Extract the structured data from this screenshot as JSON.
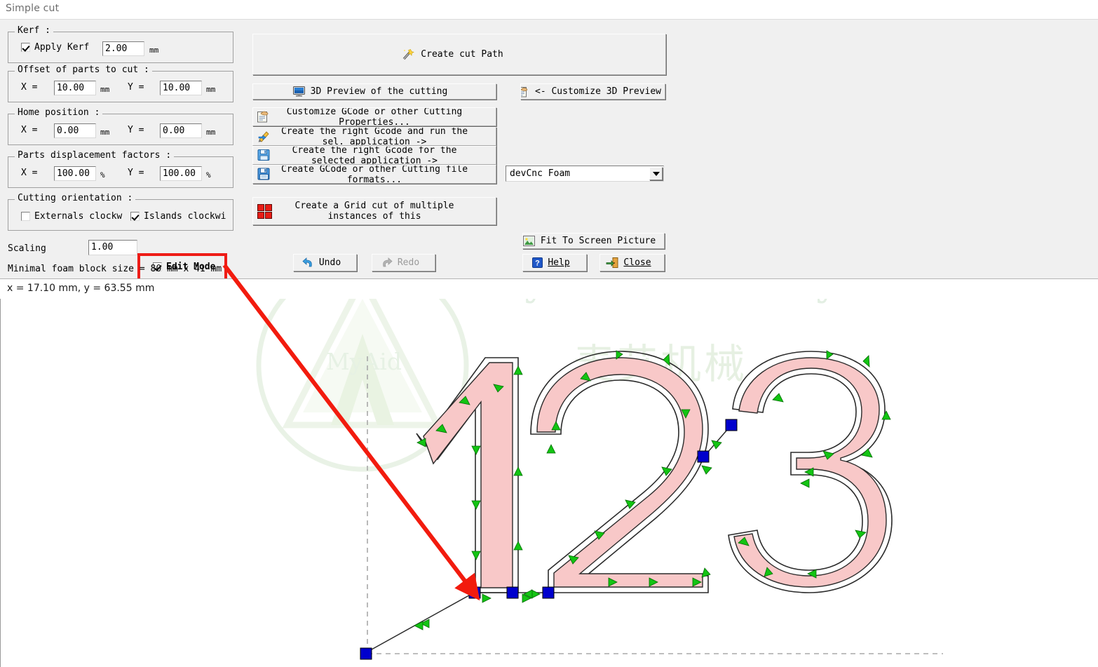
{
  "window": {
    "title": "Simple cut"
  },
  "kerf": {
    "caption": "Kerf :",
    "apply_label": "Apply Kerf",
    "apply_checked": true,
    "value": "2.00",
    "unit": "mm"
  },
  "offset": {
    "caption": "Offset of parts to cut :",
    "x_label": "X =",
    "x_value": "10.00",
    "x_unit": "mm",
    "y_label": "Y =",
    "y_value": "10.00",
    "y_unit": "mm"
  },
  "home": {
    "caption": "Home position :",
    "x_label": "X =",
    "x_value": "0.00",
    "x_unit": "mm",
    "y_label": "Y =",
    "y_value": "0.00",
    "y_unit": "mm"
  },
  "displacement": {
    "caption": "Parts displacement factors :",
    "x_label": "X =",
    "x_value": "100.00",
    "x_unit": "%",
    "y_label": "Y =",
    "y_value": "100.00",
    "y_unit": "%"
  },
  "orientation": {
    "caption": "Cutting orientation :",
    "externals_label": "Externals clockw",
    "externals_checked": false,
    "islands_label": "Islands clockwi",
    "islands_checked": true
  },
  "scaling": {
    "label": "Scaling",
    "value": "1.00",
    "edit_mode_label": "Edit Mode",
    "edit_mode_checked": true,
    "highlight_color": "#ee1c17"
  },
  "minimal_block": {
    "text": "Minimal foam block size = 80 mm x 41 mm"
  },
  "actions": {
    "create_cut_path": "Create cut Path",
    "preview_3d": "3D Preview of the cutting",
    "customize_3d_preview": "<- Customize 3D Preview",
    "customize_gcode": "Customize GCode or other Cutting Properties...",
    "create_run": "Create the right Gcode and run the sel. application ->",
    "create_for_selected": "Create the right Gcode for the selected application ->",
    "create_other_formats": "Create GCode or other Cutting file formats...",
    "grid_cut": "Create a Grid cut of multiple instances of this",
    "undo": "Undo",
    "redo": "Redo",
    "fit_to_screen": "Fit To Screen Picture",
    "help": "Help",
    "close": "Close"
  },
  "machine_select": {
    "value": "devCnc Foam",
    "arrow": "chevron-down-icon"
  },
  "status": {
    "coordinates": "x = 17.10 mm, y = 63.55 mm"
  },
  "watermark": {
    "brand_en": "Myaid Machinery",
    "logo_text": "MyAid",
    "brand_cn": "麦艾机械"
  },
  "canvas": {
    "shape_text": "123",
    "part_fill": "#f8c8c8",
    "path_color": "#2b2b2b",
    "arrow_color": "#13c413",
    "node_color": "#0000cd",
    "annotation_arrow_color": "#f21b0e",
    "guide_color": "#a8a8a8"
  }
}
